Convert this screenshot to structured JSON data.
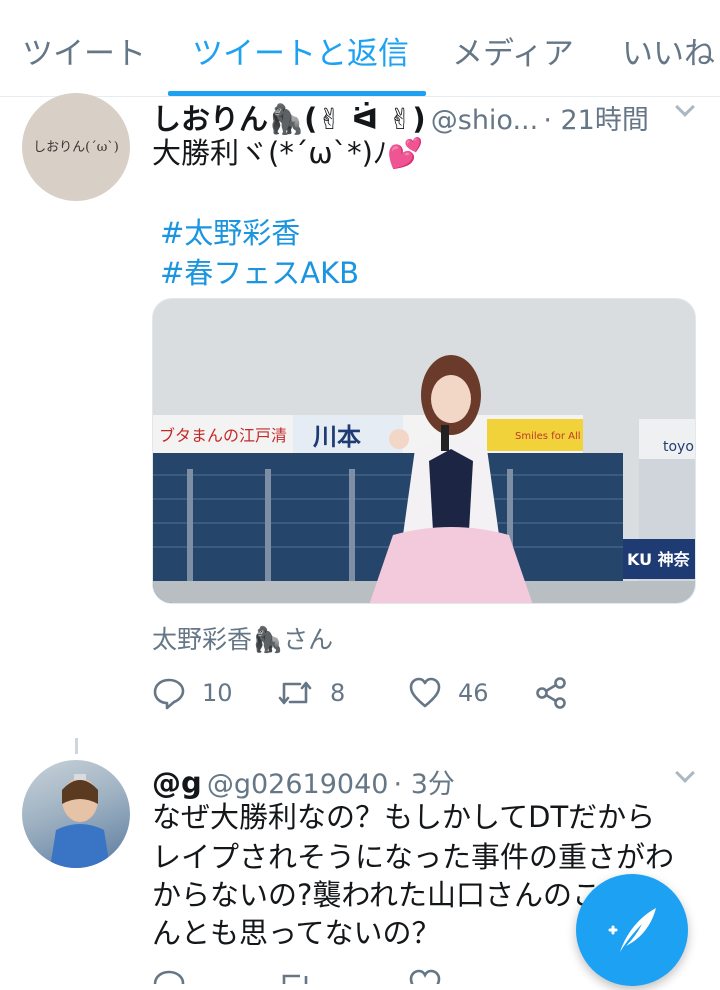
{
  "tabs": [
    {
      "label": "ツイート"
    },
    {
      "label": "ツイートと返信"
    },
    {
      "label": "メディア"
    },
    {
      "label": "いいね"
    }
  ],
  "tweet1": {
    "avatar_text": "しおりん(´ω`)",
    "name": "しおりん🦍(✌︎ ᐛ ✌︎)",
    "handle": "@shio...",
    "time": "· 21時間",
    "text": "大勝利ヾ(*´ω`*)ﾉ",
    "hashtags": [
      "#太野彩香",
      "#春フェスAKB"
    ],
    "tag_line": "太野彩香🦍さん",
    "stats": {
      "replies": "10",
      "retweets": "8",
      "likes": "46"
    }
  },
  "tweet2": {
    "name": "@g",
    "handle": "@g02619040",
    "time": "· 3分",
    "lines": [
      "なぜ大勝利なの？もしかしてDTだから",
      "レイプされそうになった事件の重さがわ",
      "からないの?襲われた山口さんのことな",
      "んとも思ってないの？"
    ]
  },
  "media": {
    "signs": [
      "ブタまんの江戸清",
      "川本",
      "Smiles for All",
      "KU 神奈",
      "toyo"
    ]
  },
  "colors": {
    "accent": "#1da1f2",
    "hashtag": "#1b95e0",
    "muted": "#657786",
    "heart": "#e0245e"
  }
}
